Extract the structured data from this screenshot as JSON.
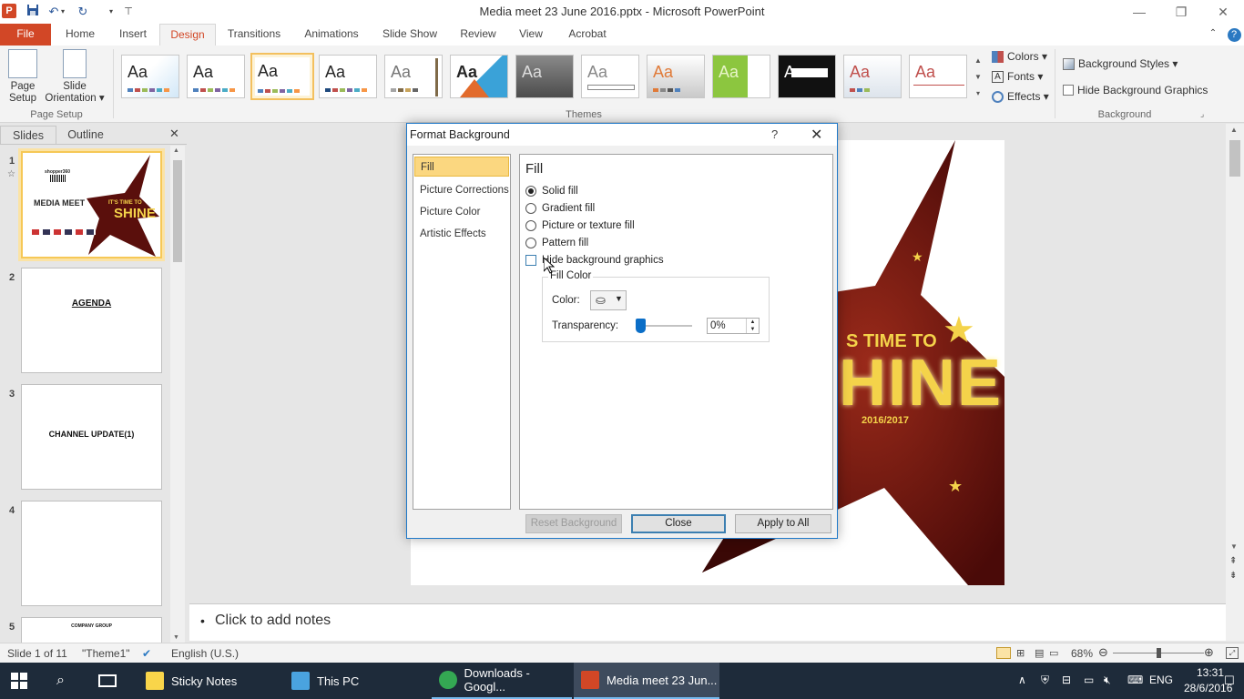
{
  "window": {
    "title": "Media meet  23 June 2016.pptx - Microsoft PowerPoint",
    "minimize_glyph": "—",
    "restore_glyph": "❐",
    "close_glyph": "✕"
  },
  "ribbon_tabs": [
    {
      "label": "File"
    },
    {
      "label": "Home"
    },
    {
      "label": "Insert"
    },
    {
      "label": "Design"
    },
    {
      "label": "Transitions"
    },
    {
      "label": "Animations"
    },
    {
      "label": "Slide Show"
    },
    {
      "label": "Review"
    },
    {
      "label": "View"
    },
    {
      "label": "Acrobat"
    }
  ],
  "ribbon": {
    "page_setup": {
      "page_setup_label": "Page\nSetup",
      "orientation_label": "Slide\nOrientation ▾",
      "group_label": "Page Setup"
    },
    "themes": {
      "group_label": "Themes",
      "sample_text": "Aa"
    },
    "theme_options": {
      "colors": "Colors ▾",
      "fonts": "Fonts ▾",
      "effects": "Effects ▾"
    },
    "background": {
      "background_styles": "Background Styles ▾",
      "hide_background_graphics": "Hide Background Graphics",
      "group_label": "Background"
    }
  },
  "slides_pane": {
    "tabs": [
      "Slides",
      "Outline"
    ],
    "close_glyph": "✕",
    "slides": [
      {
        "num": "1",
        "title": "MEDIA MEET",
        "brand": "shopper360",
        "tagline": "IT'S TIME TO",
        "headline": "SHINE"
      },
      {
        "num": "2",
        "title": "AGENDA"
      },
      {
        "num": "3",
        "title": "CHANNEL UPDATE(1)"
      },
      {
        "num": "4",
        "title": ""
      },
      {
        "num": "5",
        "title": "COMPANY GROUP"
      }
    ]
  },
  "slide_main": {
    "tagline": "S TIME TO",
    "headline": "HINE",
    "year": "2016/2017"
  },
  "notes": {
    "bullet": "•",
    "placeholder": "Click to add notes"
  },
  "dialog": {
    "title": "Format Background",
    "help": "?",
    "close": "✕",
    "nav": [
      "Fill",
      "Picture Corrections",
      "Picture Color",
      "Artistic Effects"
    ],
    "panel_heading": "Fill",
    "fill_options": [
      {
        "label": "Solid fill",
        "selected": true
      },
      {
        "label": "Gradient fill",
        "selected": false
      },
      {
        "label": "Picture or texture fill",
        "selected": false
      },
      {
        "label": "Pattern fill",
        "selected": false
      }
    ],
    "hide_bg_graphics": "Hide background graphics",
    "fill_color_legend": "Fill Color",
    "color_label": "Color:",
    "transparency_label": "Transparency:",
    "transparency_value": "0%",
    "transparency_fraction": 0,
    "buttons": {
      "reset": "Reset Background",
      "close": "Close",
      "apply_all": "Apply to All"
    }
  },
  "statusbar": {
    "slide_info": "Slide 1 of 11",
    "theme": "\"Theme1\"",
    "language": "English (U.S.)",
    "zoom": "68%",
    "zoom_fraction": 0.5
  },
  "taskbar": {
    "items": [
      {
        "label": "Sticky Notes",
        "color": "#f9d54a"
      },
      {
        "label": "This PC",
        "color": "#4aa3df"
      },
      {
        "label": "Downloads - Googl...",
        "color": "#34a853"
      },
      {
        "label": "Media meet  23 Jun...",
        "color": "#d24726"
      }
    ],
    "lang": "ENG",
    "time": "13:31",
    "date": "28/6/2016"
  },
  "colors": {
    "accent": "#d24726",
    "dialog_border": "#1e78c8",
    "selection": "#fbd780",
    "star": "#5a0f0c",
    "gold": "#f4d34a"
  }
}
